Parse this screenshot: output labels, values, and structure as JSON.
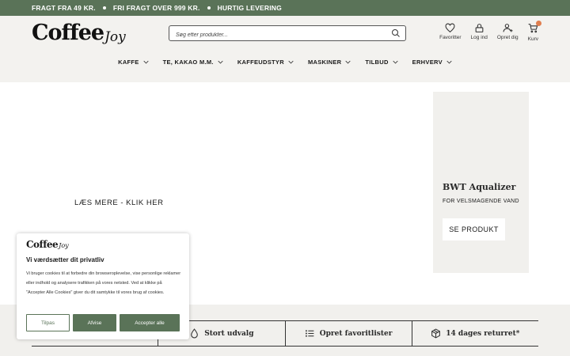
{
  "topbar": {
    "messages": [
      "FRAGT FRA 49 KR.",
      "FRI FRAGT OVER 999 KR.",
      "HURTIG LEVERING"
    ]
  },
  "header": {
    "logo_main": "Coffee",
    "logo_script": "Joy",
    "search_placeholder": "Søg efter produkter...",
    "actions": {
      "favorites": "Favoritter",
      "login": "Log ind",
      "register": "Opret dig",
      "cart": "Kurv"
    }
  },
  "nav": {
    "items": [
      "KAFFE",
      "TE, KAKAO M.M.",
      "KAFFEUDSTYR",
      "MASKINER",
      "TILBUD",
      "ERHVERV"
    ]
  },
  "hero": {
    "link_text": "LÆS MERE - KLIK HER"
  },
  "promo": {
    "title": "BWT Aqualizer",
    "subtitle": "FOR VELSMAGENDE VAND",
    "button": "SE PRODUKT"
  },
  "usps": {
    "item2": "Stort udvalg",
    "item3": "Opret favoritlister",
    "item4": "14 dages returret*"
  },
  "cookie": {
    "logo_main": "Coffee",
    "logo_script": "Joy",
    "title": "Vi værdsætter dit privatliv",
    "body": "Vi bruger cookies til at forbedre din browseroplevelse, vise personlige reklamer eller indhold og analysere trafikken på vores netsted. Ved at klikke på \"Accepter Alle Cookies\" giver du dit samtykke til vores brug af cookies.",
    "customize": "Tilpas",
    "reject": "Afvise",
    "accept": "Accepter alle"
  },
  "colors": {
    "brand_green": "#5a7358",
    "cart_badge": "#e07f4f",
    "header_bg": "#f3f2ef"
  }
}
